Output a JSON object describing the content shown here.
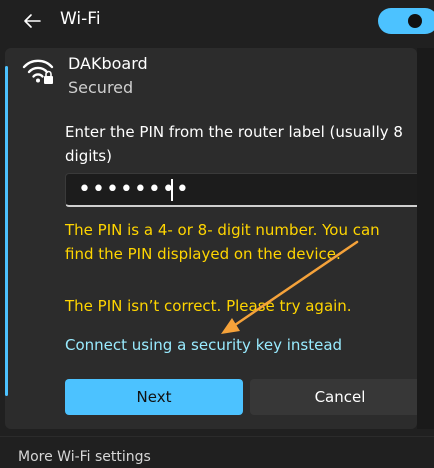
{
  "header": {
    "title": "Wi-Fi",
    "back_icon": "back-arrow-icon",
    "toggle_state": "on",
    "accent_color": "#4cc2ff"
  },
  "network": {
    "name": "DAKboard",
    "status": "Secured",
    "icon": "wifi-secured-icon"
  },
  "pin_prompt": "Enter the PIN from the router label (usually 8 digits)",
  "pin_input": {
    "value": "••••••••"
  },
  "errors": {
    "hint": "The PIN is a 4- or 8- digit number. You can find the PIN displayed on the device.",
    "incorrect": "The PIN isn’t correct. Please try again."
  },
  "alternate_link": "Connect using a security key instead",
  "buttons": {
    "next": "Next",
    "cancel": "Cancel"
  },
  "footer": {
    "more_settings": "More Wi-Fi settings"
  },
  "annotation": {
    "arrow_color": "#f5a23a"
  }
}
